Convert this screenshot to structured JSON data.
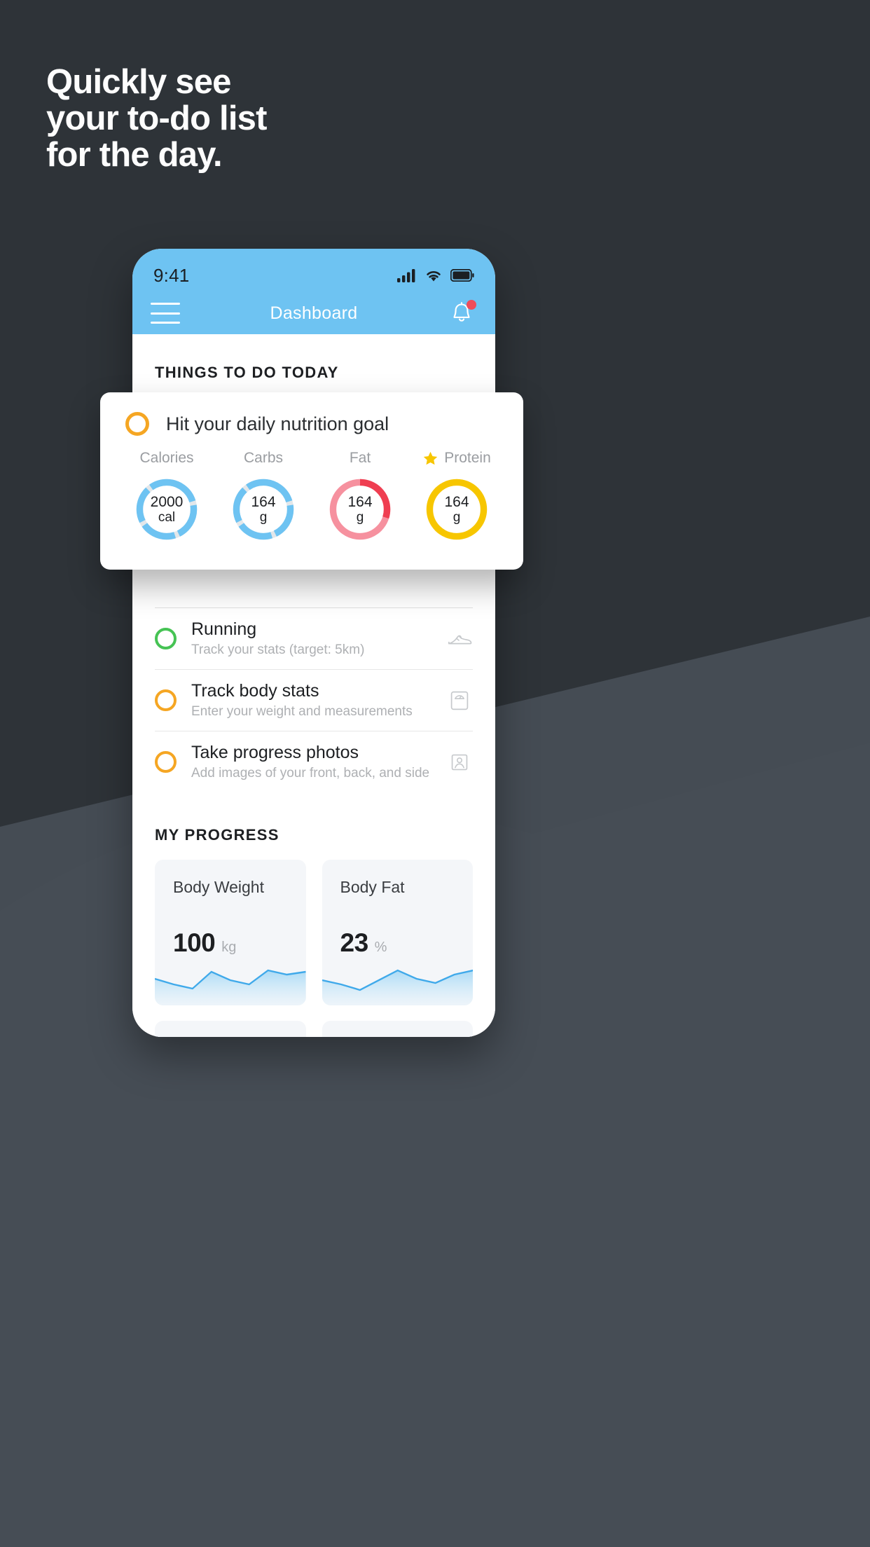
{
  "background": {
    "top_color": "#2e3338",
    "bottom_color": "#454c54"
  },
  "headline": {
    "lines": [
      "Quickly see",
      "your to-do list",
      "for the day."
    ],
    "color": "#fdfdfd"
  },
  "phone": {
    "status_bar": {
      "time": "9:41",
      "icons": [
        "signal-icon",
        "wifi-icon",
        "battery-icon"
      ],
      "background": "#6ec3f2"
    },
    "app_bar": {
      "menu_icon": "hamburger-menu-icon",
      "title": "Dashboard",
      "notification_icon": "bell-icon",
      "has_badge": true,
      "badge_color": "#ef4c5a"
    },
    "sections": {
      "todo": {
        "title": "THINGS TO DO TODAY",
        "items": [
          {
            "title": "Running",
            "subtitle": "Track your stats (target: 5km)",
            "ring_color": "#46c354",
            "icon": "running-shoe-icon"
          },
          {
            "title": "Track body stats",
            "subtitle": "Enter your weight and measurements",
            "ring_color": "#f5a623",
            "icon": "weight-scale-icon"
          },
          {
            "title": "Take progress photos",
            "subtitle": "Add images of your front, back, and side",
            "ring_color": "#f5a623",
            "icon": "person-photo-icon"
          }
        ]
      },
      "progress": {
        "title": "MY PROGRESS",
        "cards": [
          {
            "label": "Body Weight",
            "value": "100",
            "unit": "kg"
          },
          {
            "label": "Body Fat",
            "value": "23",
            "unit": "%"
          }
        ]
      }
    }
  },
  "nutrition_card": {
    "ring_color": "#f5a623",
    "title": "Hit your daily nutrition goal",
    "macros": [
      {
        "label": "Calories",
        "value": "2000",
        "unit": "cal",
        "color": "#6ec3f2",
        "track": "#e3e7ea",
        "percent": 82,
        "starred": false
      },
      {
        "label": "Carbs",
        "value": "164",
        "unit": "g",
        "color": "#6ec3f2",
        "track": "#e3e7ea",
        "percent": 82,
        "starred": false
      },
      {
        "label": "Fat",
        "value": "164",
        "unit": "g",
        "color": "#f2798c",
        "track": "#f2798c",
        "percent": 30,
        "starred": false
      },
      {
        "label": "Protein",
        "value": "164",
        "unit": "g",
        "color": "#f7c600",
        "track": "#f7c600",
        "percent": 100,
        "starred": true
      }
    ]
  },
  "chart_data": {
    "type": "area",
    "title": "My Progress sparklines",
    "series": [
      {
        "name": "Body Weight",
        "values": [
          52,
          44,
          36,
          62,
          50,
          44,
          64,
          58,
          62
        ],
        "unit": "kg",
        "current": 100,
        "color": "#3fa9ea"
      },
      {
        "name": "Body Fat",
        "values": [
          48,
          40,
          30,
          54,
          66,
          52,
          46,
          60,
          66
        ],
        "unit": "%",
        "current": 23,
        "color": "#3fa9ea"
      }
    ],
    "xlabel": "",
    "ylabel": "",
    "grid": false,
    "legend": "none"
  }
}
